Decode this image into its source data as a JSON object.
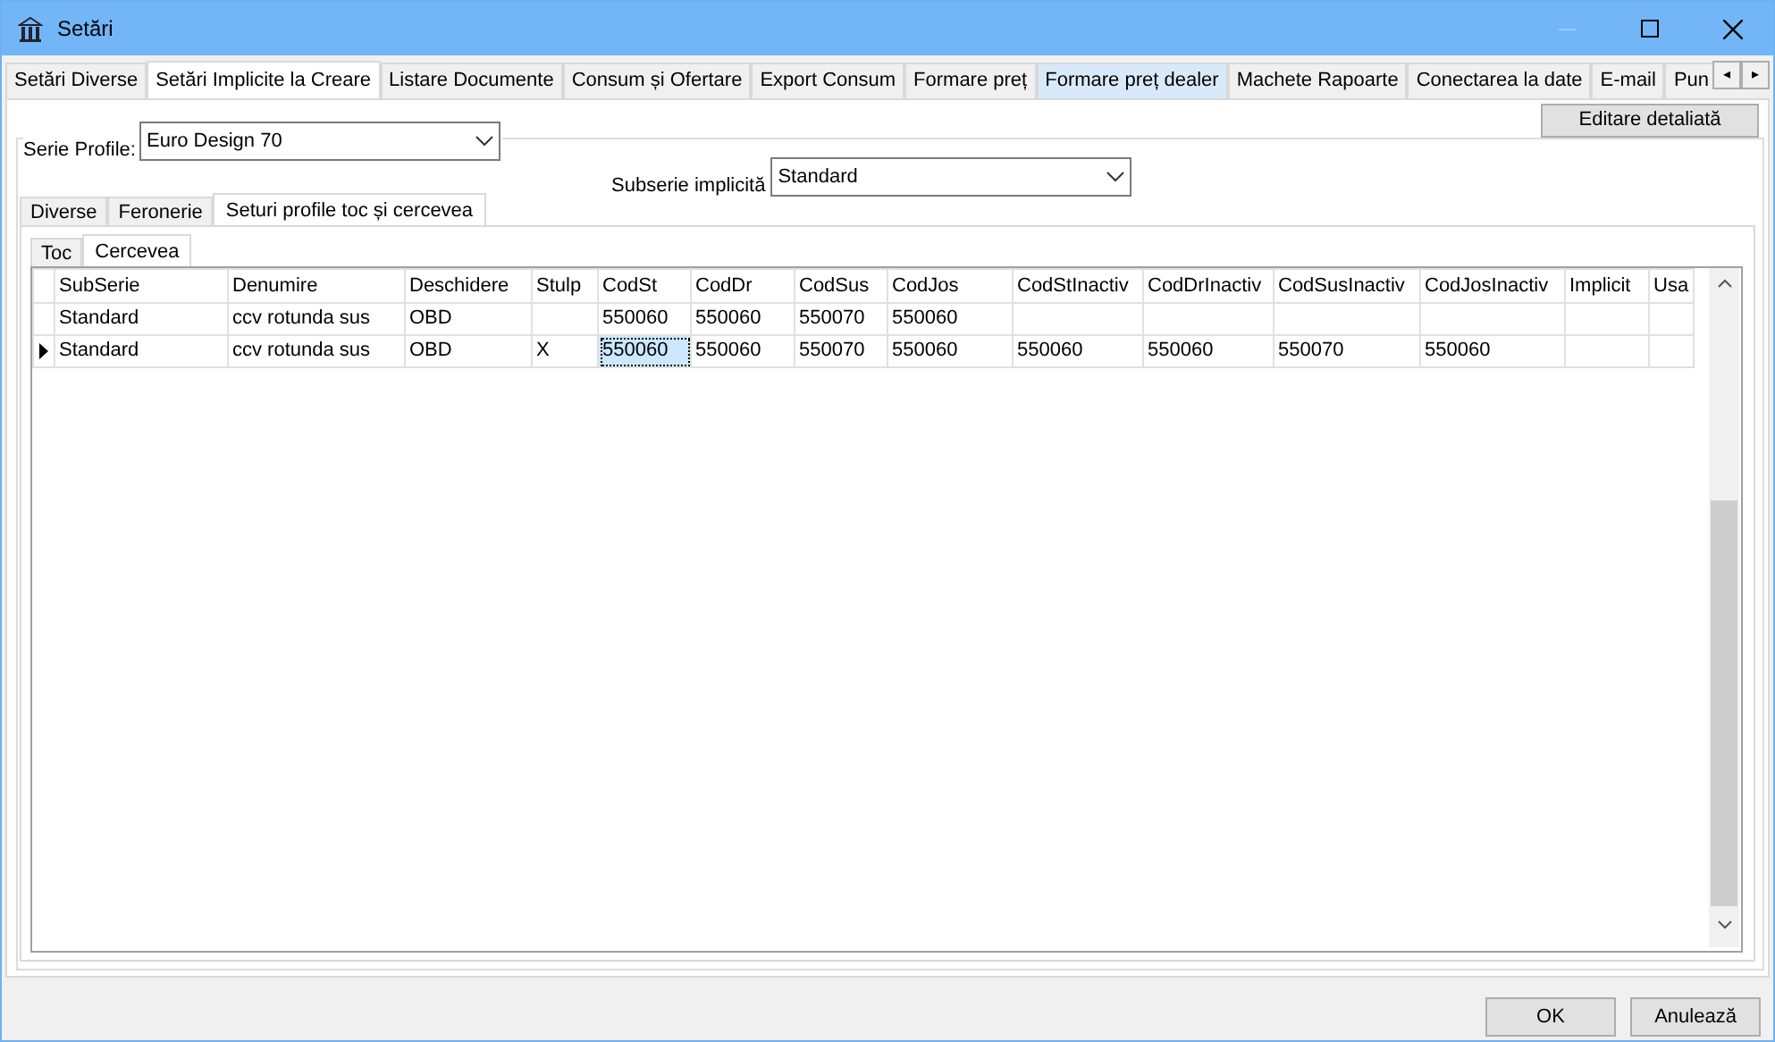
{
  "window": {
    "title": "Setări",
    "minimize_disabled": true
  },
  "tabs": [
    {
      "label": "Setări Diverse",
      "selected": false,
      "hovered": false
    },
    {
      "label": "Setări Implicite la Creare",
      "selected": true,
      "hovered": false
    },
    {
      "label": "Listare Documente",
      "selected": false,
      "hovered": false
    },
    {
      "label": "Consum și Ofertare",
      "selected": false,
      "hovered": false
    },
    {
      "label": "Export Consum",
      "selected": false,
      "hovered": false
    },
    {
      "label": "Formare preț",
      "selected": false,
      "hovered": false
    },
    {
      "label": "Formare preț dealer",
      "selected": false,
      "hovered": true
    },
    {
      "label": "Machete Rapoarte",
      "selected": false,
      "hovered": false
    },
    {
      "label": "Conectarea la date",
      "selected": false,
      "hovered": false
    },
    {
      "label": "E-mail",
      "selected": false,
      "hovered": false
    },
    {
      "label": "Pun",
      "selected": false,
      "hovered": false
    }
  ],
  "tab_scroll": {
    "left": "◂",
    "right": "▸"
  },
  "serie_profile": {
    "label": "Serie Profile:",
    "value": "Euro Design 70"
  },
  "editare_button": "Editare detaliată",
  "subserie": {
    "label": "Subserie implicită",
    "value": "Standard"
  },
  "inner_tabs": [
    {
      "label": "Diverse",
      "selected": false
    },
    {
      "label": "Feronerie",
      "selected": false
    },
    {
      "label": "Seturi profile toc și cercevea",
      "selected": true
    }
  ],
  "sub_tabs": [
    {
      "label": "Toc",
      "selected": false
    },
    {
      "label": "Cercevea",
      "selected": true
    }
  ],
  "table": {
    "columns": [
      "SubSerie",
      "Denumire",
      "Deschidere",
      "Stulp",
      "CodSt",
      "CodDr",
      "CodSus",
      "CodJos",
      "CodStInactiv",
      "CodDrInactiv",
      "CodSusInactiv",
      "CodJosInactiv",
      "Implicit",
      "Usa"
    ],
    "rows": [
      {
        "current": false,
        "cells": [
          {
            "text": "Standard",
            "selected": false
          },
          {
            "text": "ccv rotunda sus",
            "selected": false
          },
          {
            "text": "OBD",
            "selected": false
          },
          {
            "selected": false
          },
          {
            "text": "550060",
            "selected": false
          },
          {
            "text": "550060",
            "selected": false
          },
          {
            "text": "550070",
            "selected": false
          },
          {
            "text": "550060",
            "selected": false
          },
          {
            "selected": false
          },
          {
            "selected": false
          },
          {
            "selected": false
          },
          {
            "selected": false
          },
          {
            "selected": false
          },
          {
            "selected": false
          }
        ]
      },
      {
        "current": true,
        "cells": [
          {
            "text": "Standard",
            "selected": false
          },
          {
            "text": "ccv rotunda sus",
            "selected": false
          },
          {
            "text": "OBD",
            "selected": false
          },
          {
            "text": "X",
            "selected": false
          },
          {
            "text": "550060",
            "selected": true
          },
          {
            "text": "550060",
            "selected": false
          },
          {
            "text": "550070",
            "selected": false
          },
          {
            "text": "550060",
            "selected": false
          },
          {
            "text": "550060",
            "selected": false
          },
          {
            "text": "550060",
            "selected": false
          },
          {
            "text": "550070",
            "selected": false
          },
          {
            "text": "550060",
            "selected": false
          },
          {
            "selected": false
          },
          {
            "selected": false
          }
        ]
      }
    ]
  },
  "buttons": [
    "OK",
    "Anulează"
  ]
}
